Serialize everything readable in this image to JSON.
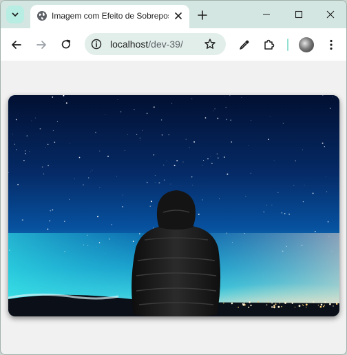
{
  "browser": {
    "tab": {
      "title": "Imagem com Efeito de Sobreposição"
    },
    "address": {
      "host": "localhost",
      "path": "/dev-39/"
    }
  },
  "content": {
    "image": {
      "subject": "man-in-black-puffer-jacket-under-starry-sky-icon",
      "colors": {
        "sky_top": "#02103a",
        "sky_mid": "#07489a",
        "horizon": "#27c5da",
        "jacket": "#1a1a1a"
      }
    }
  },
  "icons": {
    "tab_search": "chevron-down-icon",
    "favicon": "globe-icon",
    "close": "close-icon",
    "new_tab": "plus-icon",
    "back": "arrow-left-icon",
    "forward": "arrow-right-icon",
    "reload": "reload-icon",
    "site_info": "info-icon",
    "bookmark": "star-icon",
    "eyedropper": "eyedropper-icon",
    "extensions": "puzzle-icon",
    "menu": "kebab-menu-icon"
  }
}
